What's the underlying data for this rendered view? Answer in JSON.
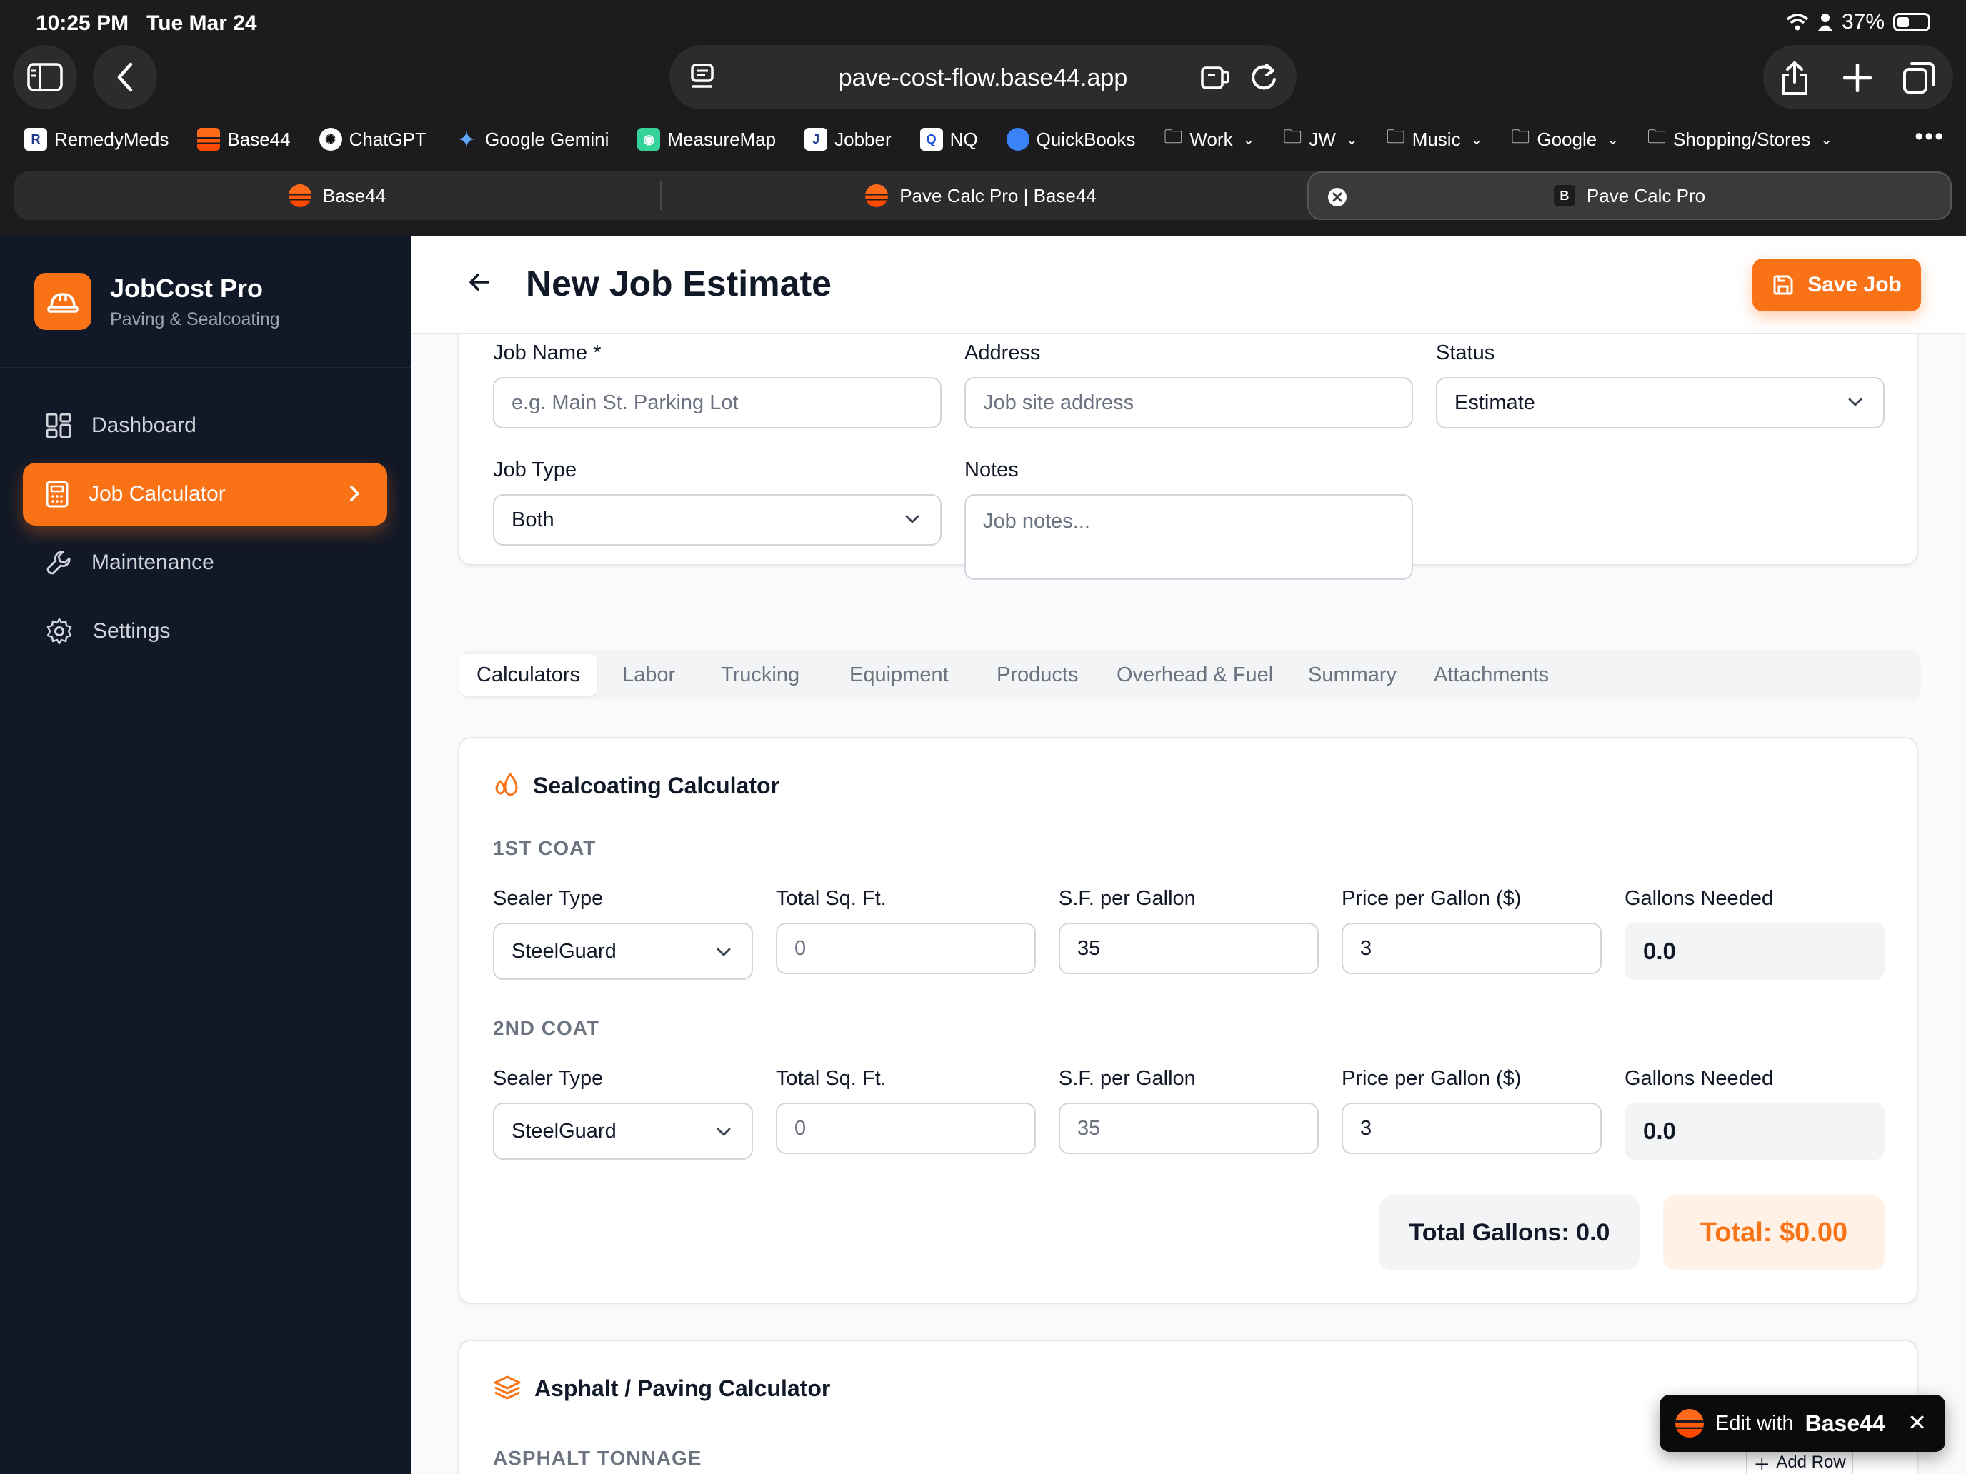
{
  "status_bar": {
    "time": "10:25 PM",
    "date": "Tue Mar 24",
    "battery": "37%"
  },
  "browser": {
    "url": "pave-cost-flow.base44.app",
    "bookmarks": [
      {
        "label": "RemedyMeds"
      },
      {
        "label": "Base44"
      },
      {
        "label": "ChatGPT"
      },
      {
        "label": "Google Gemini"
      },
      {
        "label": "MeasureMap"
      },
      {
        "label": "Jobber"
      },
      {
        "label": "NQ"
      },
      {
        "label": "QuickBooks"
      },
      {
        "label": "Work"
      },
      {
        "label": "JW"
      },
      {
        "label": "Music"
      },
      {
        "label": "Google"
      },
      {
        "label": "Shopping/Stores"
      }
    ],
    "more": "•••",
    "tabs": [
      {
        "label": "Base44"
      },
      {
        "label": "Pave Calc Pro | Base44"
      },
      {
        "label": "Pave Calc Pro",
        "badge": "B"
      }
    ]
  },
  "sidebar": {
    "app_name": "JobCost Pro",
    "app_sub": "Paving & Sealcoating",
    "items": [
      {
        "label": "Dashboard"
      },
      {
        "label": "Job Calculator"
      },
      {
        "label": "Maintenance"
      },
      {
        "label": "Settings"
      }
    ]
  },
  "header": {
    "title": "New Job Estimate",
    "save_label": "Save Job"
  },
  "job_form": {
    "job_name_label": "Job Name *",
    "job_name_placeholder": "e.g. Main St. Parking Lot",
    "address_label": "Address",
    "address_placeholder": "Job site address",
    "status_label": "Status",
    "status_value": "Estimate",
    "job_type_label": "Job Type",
    "job_type_value": "Both",
    "notes_label": "Notes",
    "notes_placeholder": "Job notes..."
  },
  "tabs": [
    "Calculators",
    "Labor",
    "Trucking",
    "Equipment",
    "Products",
    "Overhead & Fuel",
    "Summary",
    "Attachments"
  ],
  "sealcoating": {
    "title": "Sealcoating Calculator",
    "labels": {
      "sealer_type": "Sealer Type",
      "total_sqft": "Total Sq. Ft.",
      "sf_per_gallon": "S.F. per Gallon",
      "price_per_gallon": "Price per Gallon ($)",
      "gallons_needed": "Gallons Needed"
    },
    "coats": [
      {
        "heading": "1ST COAT",
        "sealer_type": "SteelGuard",
        "total_sqft_placeholder": "0",
        "sf_per_gallon": "35",
        "price_per_gallon": "3",
        "gallons_needed": "0.0"
      },
      {
        "heading": "2ND COAT",
        "sealer_type": "SteelGuard",
        "total_sqft_placeholder": "0",
        "sf_per_gallon_placeholder": "35",
        "price_per_gallon": "3",
        "gallons_needed": "0.0"
      }
    ],
    "total_gallons": "Total Gallons: 0.0",
    "total_cost": "Total: $0.00"
  },
  "asphalt": {
    "title": "Asphalt / Paving Calculator",
    "section": "ASPHALT TONNAGE",
    "add_row": "Add Row"
  },
  "edit_badge": {
    "prefix": "Edit with",
    "brand": "Base44"
  },
  "colors": {
    "accent": "#f97316",
    "sidebar_bg": "#111827",
    "page_bg": "#f9fafb"
  }
}
